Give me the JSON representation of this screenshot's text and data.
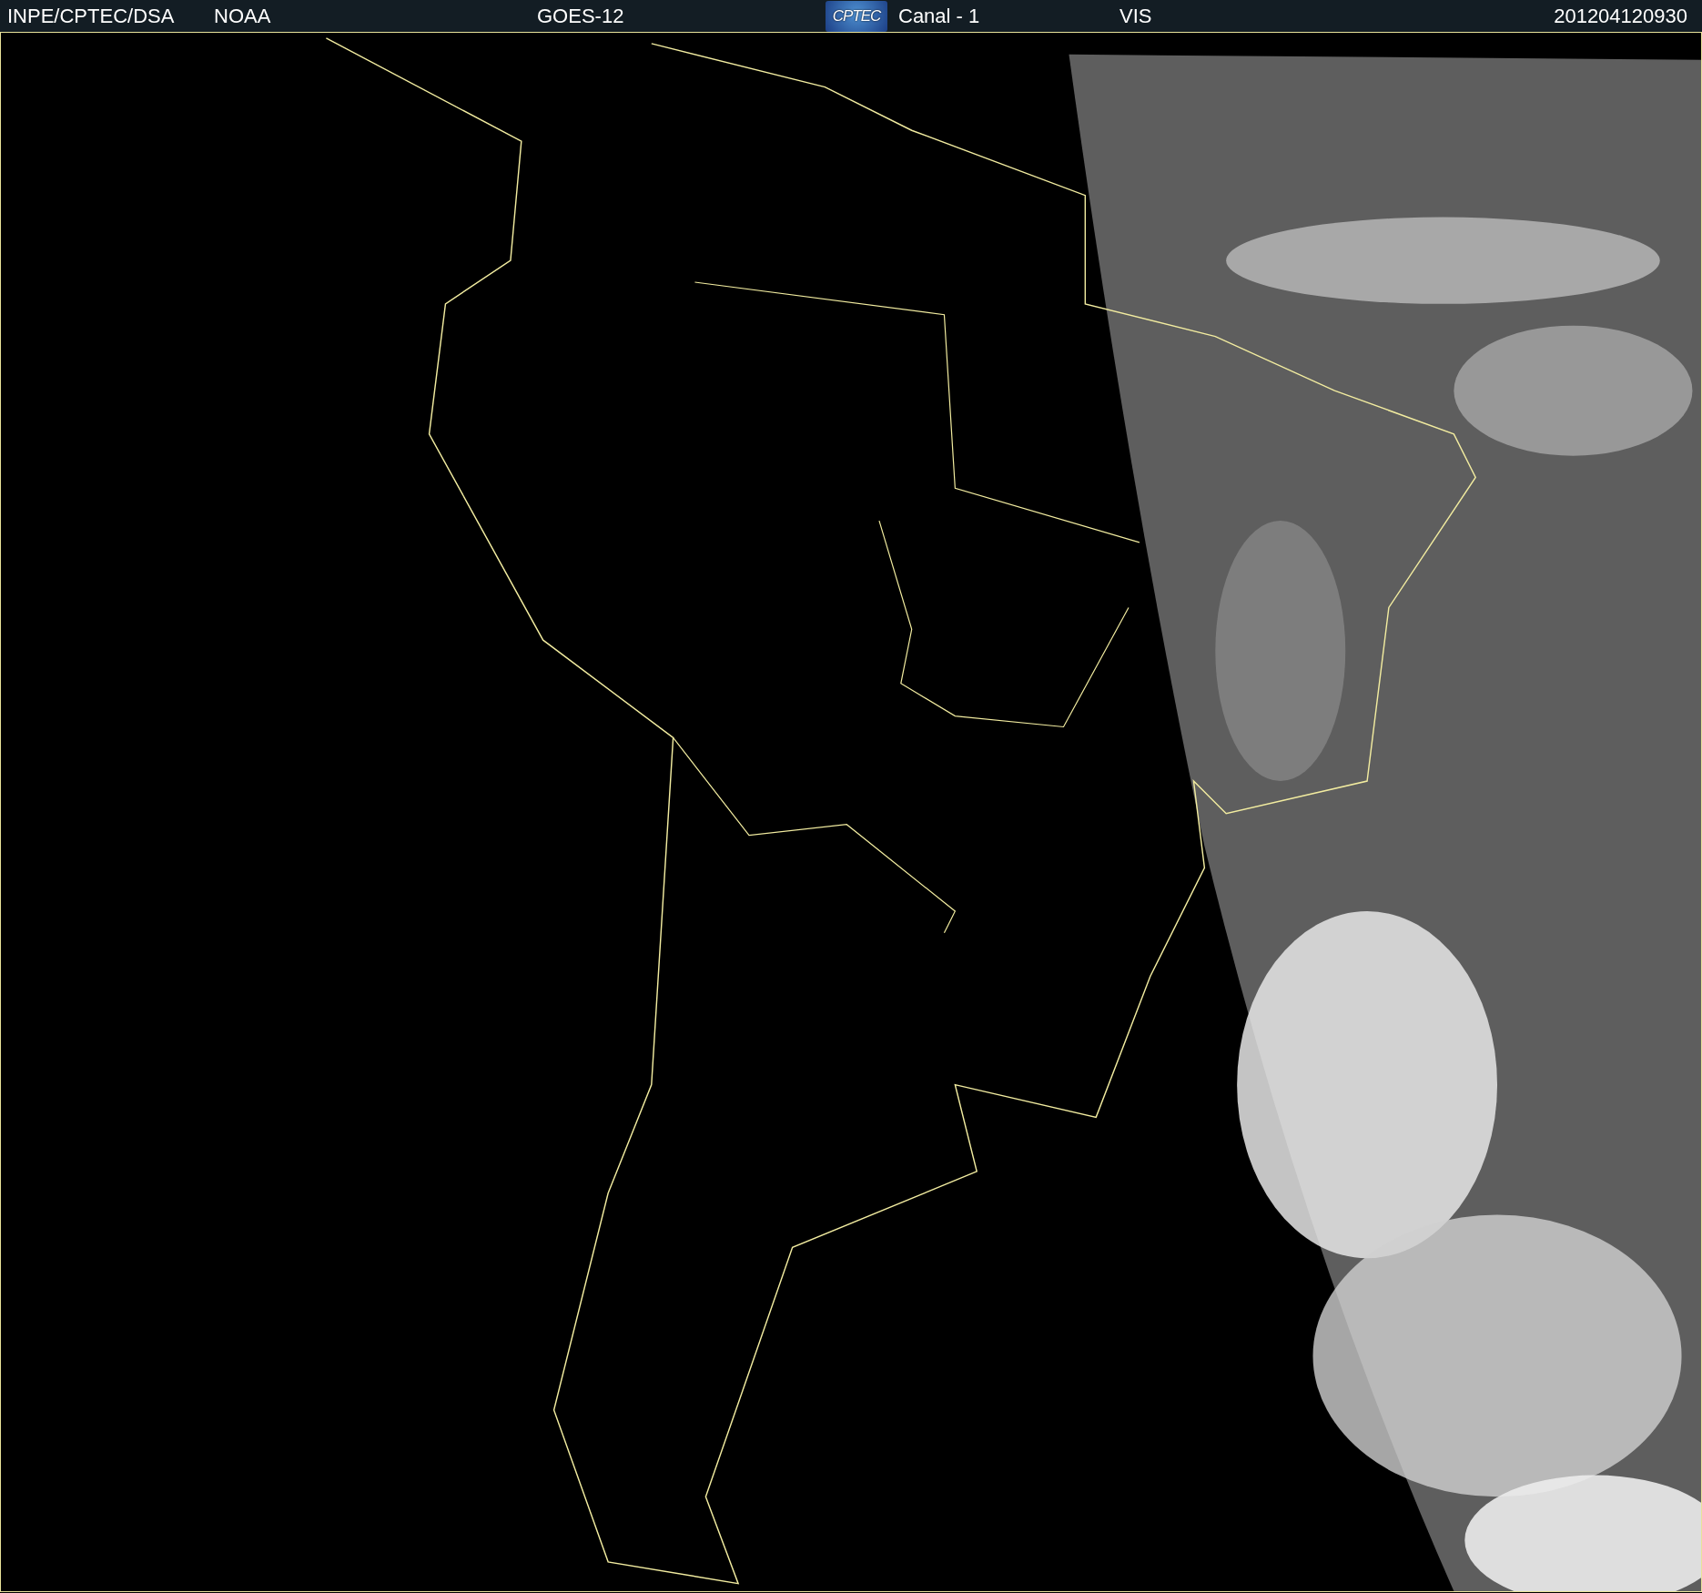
{
  "header": {
    "source": "INPE/CPTEC/DSA",
    "agency": "NOAA",
    "satellite": "GOES-12",
    "logo": "CPTEC",
    "channel": "Canal - 1",
    "band": "VIS",
    "timestamp": "201204120930"
  }
}
